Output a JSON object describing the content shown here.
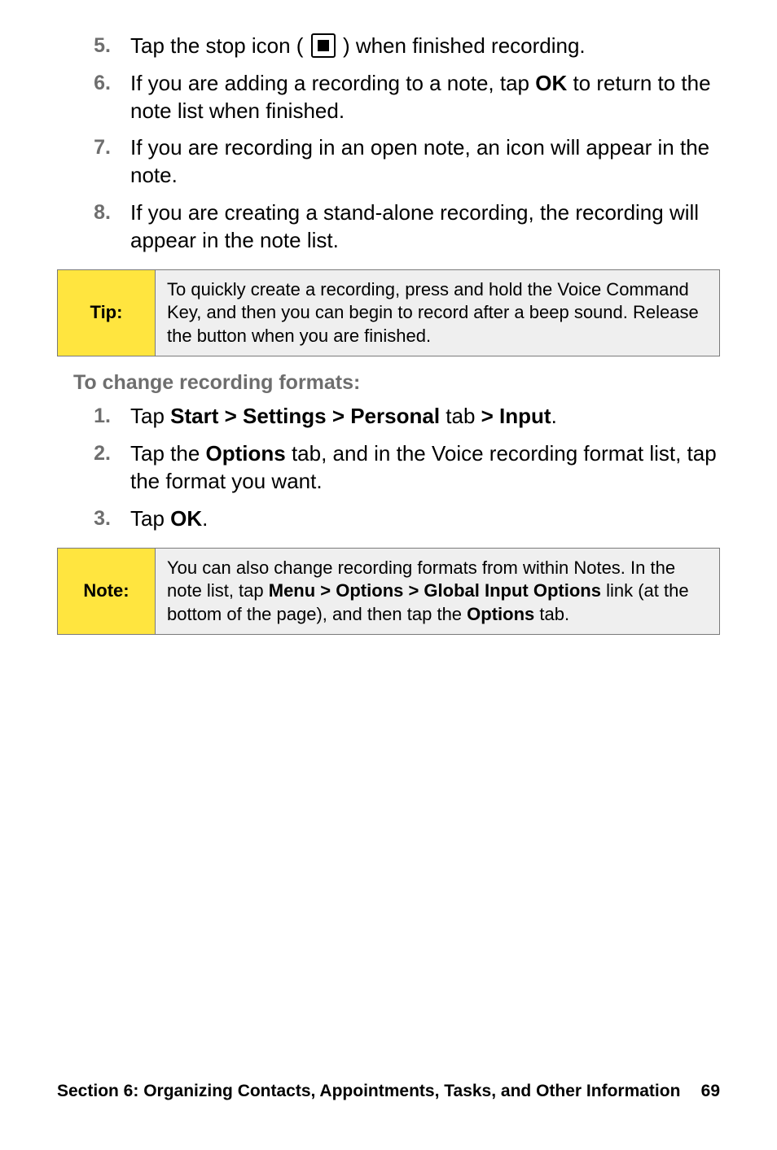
{
  "list1": {
    "items": [
      {
        "num": "5.",
        "pre": "Tap the stop icon (",
        "post": ") when finished recording."
      },
      {
        "num": "6.",
        "text_pre": "If you are adding a recording to a note, tap ",
        "bold": "OK",
        "text_post": " to return to the note list when finished."
      },
      {
        "num": "7.",
        "text": "If you are recording in an open note, an icon will appear in the note."
      },
      {
        "num": "8.",
        "text": "If you are creating a stand-alone recording, the recording will appear in the note list."
      }
    ]
  },
  "tip": {
    "label": "Tip:",
    "body": "To quickly create a recording, press and hold the Voice Command Key, and then you can begin to record after a beep sound. Release the button when you are finished."
  },
  "subhead": "To change recording formats:",
  "list2": {
    "items": [
      {
        "num": "1.",
        "pre": "Tap ",
        "b1": "Start > Settings > Personal",
        "mid": " tab ",
        "b2": "> Input",
        "post": "."
      },
      {
        "num": "2.",
        "pre": "Tap the ",
        "b1": "Options",
        "post": " tab, and in the Voice recording format list, tap the format you want."
      },
      {
        "num": "3.",
        "pre": "Tap ",
        "b1": "OK",
        "post": "."
      }
    ]
  },
  "note": {
    "label": "Note:",
    "p1": "You can also change recording formats from within Notes. In the note list, tap ",
    "b1": "Menu > Options > Global Input Options",
    "p2": " link (at the bottom of the page), and then tap the ",
    "b2": "Options",
    "p3": " tab."
  },
  "footer": {
    "section": "Section 6: Organizing Contacts, Appointments, Tasks, and Other Information",
    "page": "69"
  }
}
